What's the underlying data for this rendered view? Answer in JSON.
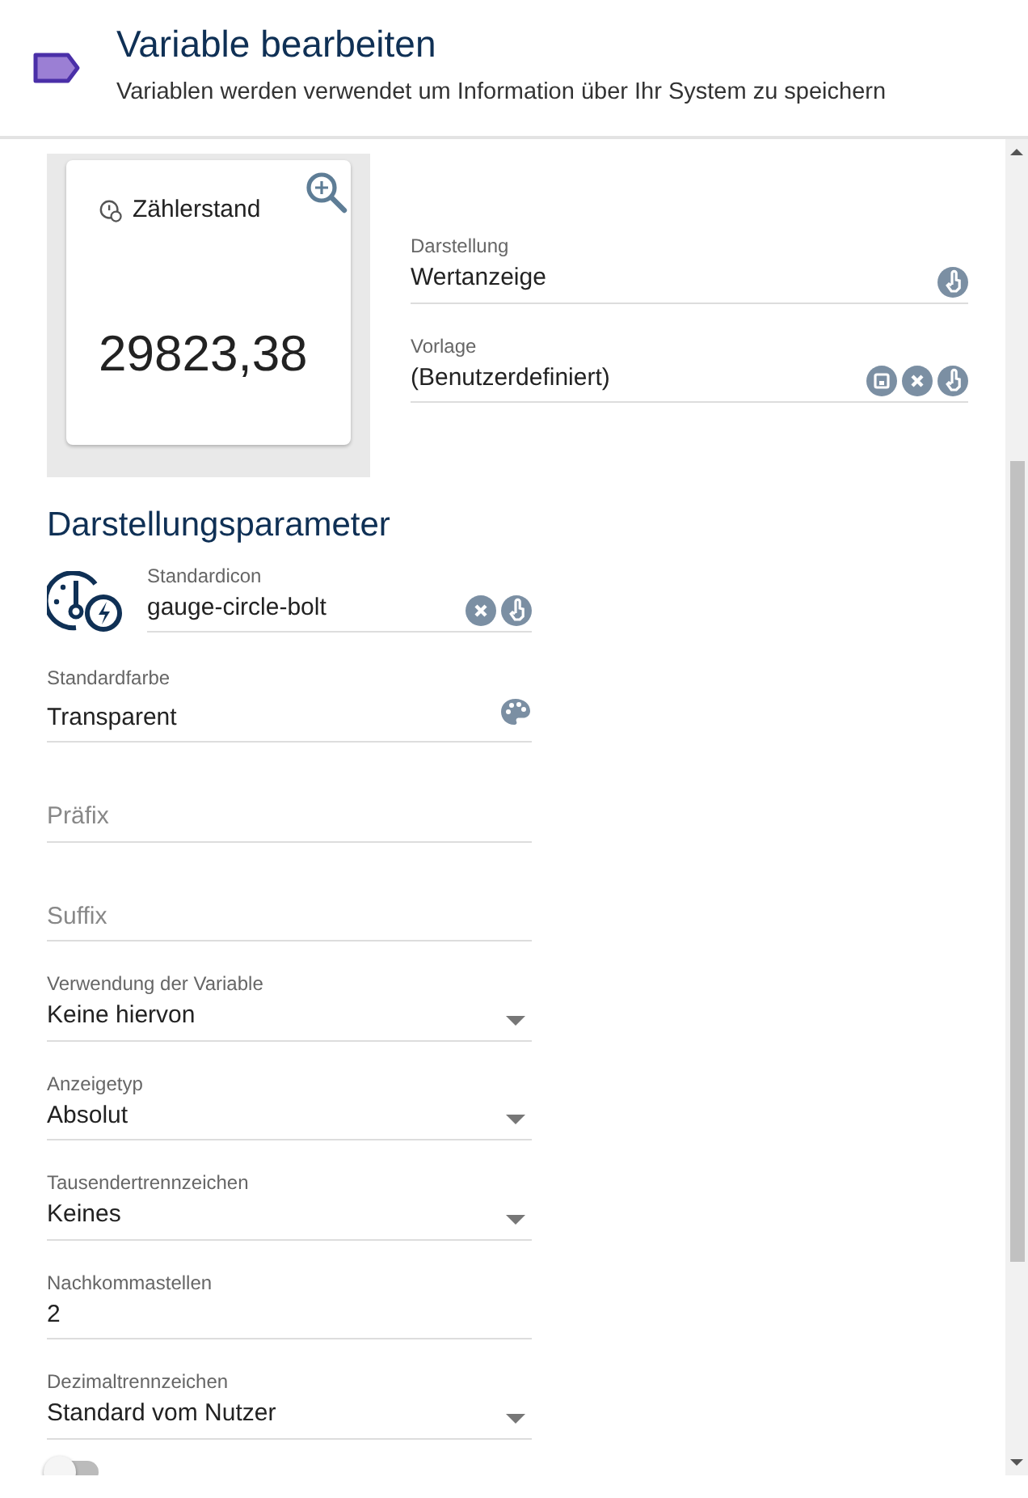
{
  "header": {
    "title": "Variable bearbeiten",
    "subtitle": "Variablen werden verwendet um Information über Ihr System zu speichern"
  },
  "preview": {
    "label": "Zählerstand",
    "value": "29823,38"
  },
  "display_fields": [
    {
      "label": "Darstellung",
      "value": "Wertanzeige",
      "actions": [
        {
          "kind": "select"
        }
      ]
    },
    {
      "label": "Vorlage",
      "value": "(Benutzerdefiniert)",
      "actions": [
        {
          "kind": "save"
        },
        {
          "kind": "clear"
        },
        {
          "kind": "select"
        }
      ]
    }
  ],
  "section_title": "Darstellungsparameter",
  "fields": [
    {
      "kind": "icon",
      "label": "Standardicon",
      "value": "gauge-circle-bolt",
      "actions": [
        {
          "kind": "clear"
        },
        {
          "kind": "select"
        }
      ]
    },
    {
      "kind": "text",
      "label": "Standardfarbe",
      "value": "Transparent",
      "actions": [
        {
          "kind": "palette"
        }
      ]
    },
    {
      "kind": "text",
      "placeholder": "Präfix"
    },
    {
      "kind": "text",
      "placeholder": "Suffix"
    },
    {
      "kind": "select",
      "label": "Verwendung der Variable",
      "value": "Keine hiervon"
    },
    {
      "kind": "select",
      "label": "Anzeigetyp",
      "value": "Absolut"
    },
    {
      "kind": "select",
      "label": "Tausendertrennzeichen",
      "value": "Keines"
    },
    {
      "kind": "text",
      "label": "Nachkommastellen",
      "value": "2"
    },
    {
      "kind": "select",
      "label": "Dezimaltrennzeichen",
      "value": "Standard vom Nutzer"
    },
    {
      "kind": "toggle",
      "on": false
    }
  ]
}
